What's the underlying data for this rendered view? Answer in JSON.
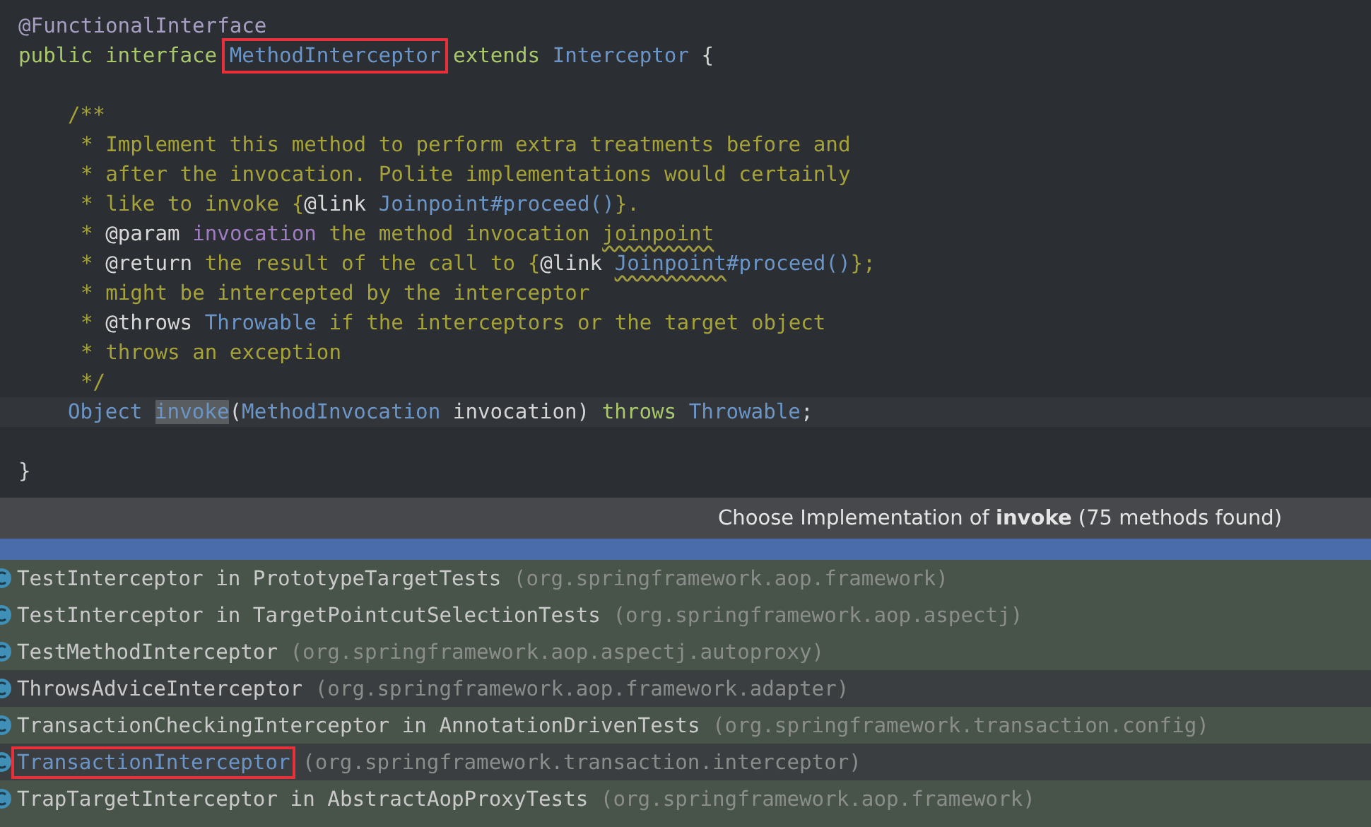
{
  "editor": {
    "lines": [
      {
        "kind": "top",
        "segments": [
          {
            "text": "@FunctionalInterface",
            "kind": "annotation"
          }
        ]
      },
      {
        "kind": "top",
        "segments": [
          {
            "text": "public interface ",
            "kind": "keyword"
          },
          {
            "text": "MethodInterceptor",
            "kind": "type",
            "boxed": true
          },
          {
            "text": " extends ",
            "kind": "keyword"
          },
          {
            "text": "Interceptor",
            "kind": "type"
          },
          {
            "text": " {",
            "kind": "plain"
          }
        ]
      },
      {
        "kind": "blank"
      },
      {
        "kind": "member",
        "segments": [
          {
            "text": "/**",
            "kind": "comment"
          }
        ]
      },
      {
        "kind": "doc",
        "segments": [
          {
            "text": "* Implement this method to perform extra treatments before and",
            "kind": "comment"
          }
        ]
      },
      {
        "kind": "doc",
        "segments": [
          {
            "text": "* after the invocation. Polite implementations would certainly",
            "kind": "comment"
          }
        ]
      },
      {
        "kind": "doc",
        "segments": [
          {
            "text": "* like to invoke {",
            "kind": "comment"
          },
          {
            "text": "@link",
            "kind": "doctag"
          },
          {
            "text": " Joinpoint#proceed()",
            "kind": "type"
          },
          {
            "text": "}.",
            "kind": "comment"
          }
        ]
      },
      {
        "kind": "doc",
        "segments": [
          {
            "text": "* ",
            "kind": "comment"
          },
          {
            "text": "@param",
            "kind": "doctag"
          },
          {
            "text": " invocation",
            "kind": "param"
          },
          {
            "text": " the method invocation ",
            "kind": "comment"
          },
          {
            "text": "joinpoint",
            "kind": "comment",
            "typo": true
          }
        ]
      },
      {
        "kind": "doc",
        "segments": [
          {
            "text": "* ",
            "kind": "comment"
          },
          {
            "text": "@return",
            "kind": "doctag"
          },
          {
            "text": " the result of the call to {",
            "kind": "comment"
          },
          {
            "text": "@link ",
            "kind": "doctag"
          },
          {
            "text": "Joinpoint",
            "kind": "type",
            "typo": true
          },
          {
            "text": "#proceed()",
            "kind": "type"
          },
          {
            "text": "};",
            "kind": "comment"
          }
        ]
      },
      {
        "kind": "doc",
        "segments": [
          {
            "text": "* might be intercepted by the interceptor",
            "kind": "comment"
          }
        ]
      },
      {
        "kind": "doc",
        "segments": [
          {
            "text": "* ",
            "kind": "comment"
          },
          {
            "text": "@throws",
            "kind": "doctag"
          },
          {
            "text": " Throwable",
            "kind": "type"
          },
          {
            "text": " if the interceptors or the target object",
            "kind": "comment"
          }
        ]
      },
      {
        "kind": "doc",
        "segments": [
          {
            "text": "* throws an exception",
            "kind": "comment"
          }
        ]
      },
      {
        "kind": "doc",
        "segments": [
          {
            "text": "*/",
            "kind": "comment"
          }
        ]
      },
      {
        "kind": "member",
        "current": true,
        "segments": [
          {
            "text": "Object ",
            "kind": "type"
          },
          {
            "text": "invoke",
            "kind": "type",
            "usage": true
          },
          {
            "text": "(",
            "kind": "plain"
          },
          {
            "text": "MethodInvocation",
            "kind": "type"
          },
          {
            "text": " invocation) ",
            "kind": "plain"
          },
          {
            "text": "throws ",
            "kind": "keyword"
          },
          {
            "text": "Throwable",
            "kind": "type"
          },
          {
            "text": ";",
            "kind": "plain"
          }
        ]
      },
      {
        "kind": "blank"
      },
      {
        "kind": "top",
        "segments": [
          {
            "text": "}",
            "kind": "plain"
          }
        ]
      }
    ]
  },
  "popup": {
    "title": "Choose Implementation of **invoke** (75 methods found)",
    "items": [
      {
        "kind": "test",
        "selected": true,
        "boxed": false
      },
      {
        "name": "TestInterceptor in PrototypeTargetTests",
        "location": "(org.springframework.aop.framework)",
        "kind": "test",
        "selected": false,
        "boxed": false
      },
      {
        "name": "TestInterceptor in TargetPointcutSelectionTests",
        "location": "(org.springframework.aop.aspectj)",
        "kind": "test",
        "selected": false,
        "boxed": false
      },
      {
        "name": "TestMethodInterceptor",
        "location": "(org.springframework.aop.aspectj.autoproxy)",
        "kind": "test",
        "selected": false,
        "boxed": false
      },
      {
        "name": "ThrowsAdviceInterceptor",
        "location": "(org.springframework.aop.framework.adapter)",
        "kind": "source",
        "selected": false,
        "boxed": false
      },
      {
        "name": "TransactionCheckingInterceptor in AnnotationDrivenTests",
        "location": "(org.springframework.transaction.config)",
        "kind": "test",
        "selected": false,
        "boxed": false
      },
      {
        "name": "TransactionInterceptor",
        "location": "(org.springframework.transaction.interceptor)",
        "kind": "source",
        "selected": false,
        "boxed": true
      },
      {
        "name": "TrapTargetInterceptor in AbstractAopProxyTests",
        "location": "(org.springframework.aop.framework)",
        "kind": "test",
        "selected": false,
        "boxed": false
      }
    ]
  }
}
